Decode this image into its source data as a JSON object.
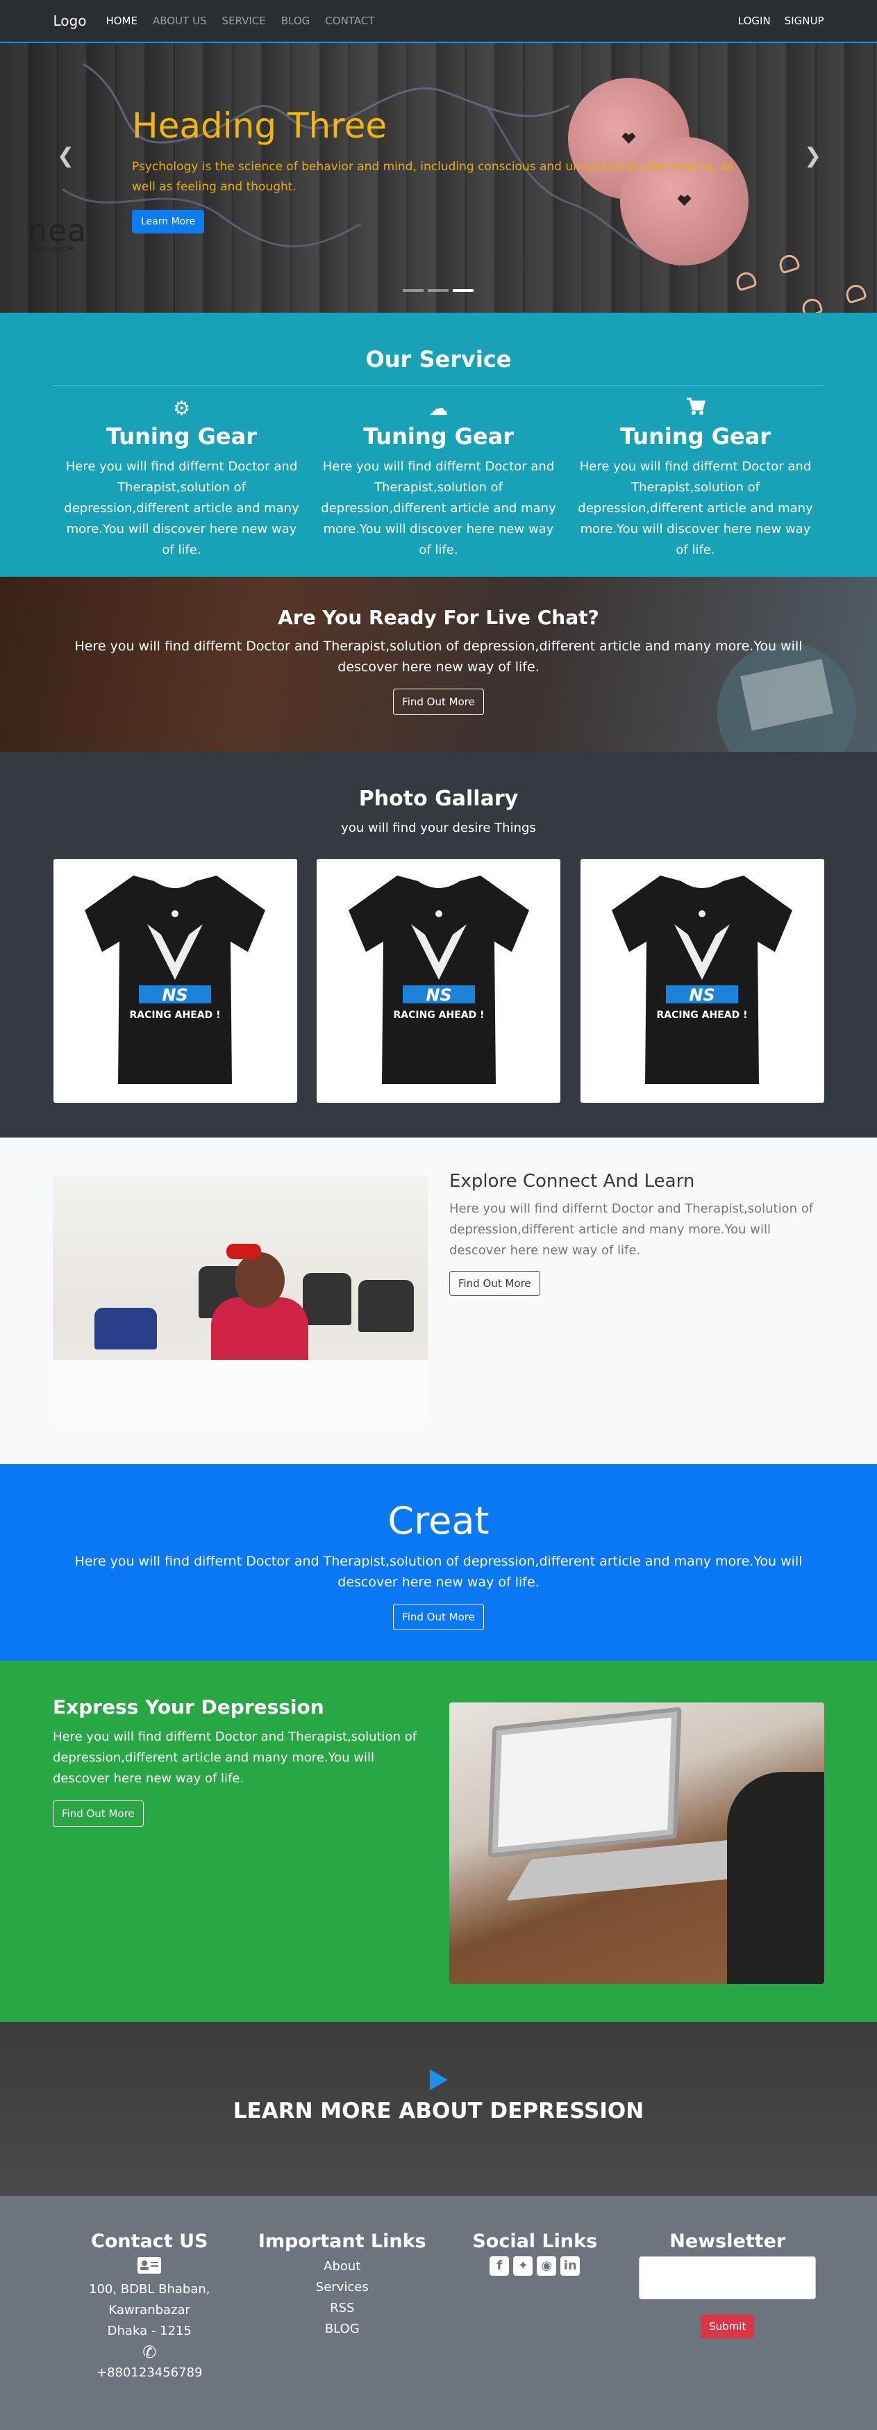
{
  "navbar": {
    "brand": "Logo",
    "links": [
      "HOME",
      "ABOUT US",
      "SERVICE",
      "BLOG",
      "CONTACT"
    ],
    "right": [
      "LOGIN",
      "SIGNUP"
    ]
  },
  "hero": {
    "title": "Heading Three",
    "text": "Psychology is the science of behavior and mind, including conscious and unconscious phenomena, as well as feeling and thought.",
    "button": "Learn More",
    "watermark_big": "nea",
    "watermark_small": "NEARCLE.COM",
    "prev_icon": "chevron-left-icon",
    "next_icon": "chevron-right-icon",
    "slides_count": 3,
    "active_slide": 3
  },
  "service": {
    "title": "Our Service",
    "items": [
      {
        "icon": "gears-icon",
        "title": "Tuning Gear",
        "text": "Here you will find differnt Doctor and Therapist,solution of depression,different article and many more.You will discover here new way of life."
      },
      {
        "icon": "cloud-icon",
        "title": "Tuning Gear",
        "text": "Here you will find differnt Doctor and Therapist,solution of depression,different article and many more.You will discover here new way of life."
      },
      {
        "icon": "cart-icon",
        "title": "Tuning Gear",
        "text": "Here you will find differnt Doctor and Therapist,solution of depression,different article and many more.You will discover here new way of life."
      }
    ]
  },
  "livechat": {
    "title": "Are You Ready For Live Chat?",
    "text": "Here you will find differnt Doctor and Therapist,solution of depression,different article and many more.You will descover here new way of life.",
    "button": "Find Out More"
  },
  "gallery": {
    "title": "Photo Gallary",
    "subtitle": "you will find your desire Things",
    "shirt_text_top": "NS",
    "shirt_text_bottom": "RACING AHEAD !"
  },
  "explore": {
    "title": "Explore Connect And Learn",
    "text": "Here you will find differnt Doctor and Therapist,solution of depression,different article and many more.You will descover here new way of life.",
    "button": "Find Out More"
  },
  "creat": {
    "title": "Creat",
    "text": "Here you will find differnt Doctor and Therapist,solution of depression,different article and many more.You will descover here new way of life.",
    "button": "Find Out More"
  },
  "express": {
    "title": "Express Your Depression",
    "text": "Here you will find differnt Doctor and Therapist,solution of depression,different article and many more.You will descover here new way of life.",
    "button": "Find Out More"
  },
  "learnmore": {
    "icon": "play-icon",
    "title": "LEARN MORE ABOUT DEPRESSION"
  },
  "footer": {
    "contact": {
      "title": "Contact US",
      "address_icon": "address-card-icon",
      "address": [
        "100, BDBL Bhaban,",
        "Kawranbazar",
        "Dhaka - 1215"
      ],
      "phone_icon": "phone-icon",
      "phone": "+880123456789"
    },
    "links": {
      "title": "Important Links",
      "items": [
        "About",
        "Services",
        "RSS",
        "BLOG"
      ]
    },
    "social": {
      "title": "Social Links",
      "icons": [
        "facebook-icon",
        "twitter-icon",
        "instagram-icon",
        "linkedin-icon"
      ]
    },
    "newsletter": {
      "title": "Newsletter",
      "button": "Submit"
    }
  },
  "colors": {
    "nav_bg": "#2a2d31",
    "hero_title": "#f5b800",
    "primary": "#0d7cf0",
    "info": "#17a2b8",
    "dark": "#343a40",
    "light": "#f8f9fa",
    "success": "#28a745",
    "danger": "#dc3545",
    "footer": "#6c757d"
  }
}
